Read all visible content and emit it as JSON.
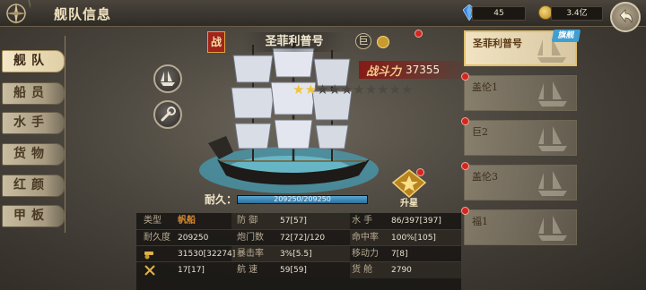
{
  "header": {
    "title": "舰队信息"
  },
  "currency": {
    "gems": "45",
    "coins": "3.4亿",
    "gem_icon": "blue-gem-icon",
    "coin_icon": "gold-coin-icon"
  },
  "nav": {
    "items": [
      {
        "label": "舰队",
        "active": true
      },
      {
        "label": "船员"
      },
      {
        "label": "水手"
      },
      {
        "label": "货物"
      },
      {
        "label": "红颜"
      },
      {
        "label": "甲板"
      }
    ]
  },
  "ship": {
    "type_badge": "战",
    "name": "圣菲利普号",
    "rank_badge": "巨",
    "power_label": "战斗力",
    "power_value": "37355",
    "stars_total": 10,
    "stars_filled": 2,
    "durability_label": "耐久：",
    "durability_text": "209250/209250",
    "durability_fraction": 1.0,
    "upgrade_label": "升星"
  },
  "stats": [
    [
      {
        "k": "类型",
        "v": "帆船"
      },
      {
        "k": "防 御",
        "v": "57[57]"
      },
      {
        "k": "水 手",
        "v": "86/397[397]"
      }
    ],
    [
      {
        "k": "耐久度",
        "v": "209250"
      },
      {
        "k": "炮门数",
        "v": "72[72]/120"
      },
      {
        "k": "命中率",
        "v": "100%[105]"
      }
    ],
    [
      {
        "k": "",
        "v": "31530[32274]"
      },
      {
        "k": "暴击率",
        "v": "3%[5.5]"
      },
      {
        "k": "移动力",
        "v": "7[8]"
      }
    ],
    [
      {
        "k": "",
        "v": "17[17]"
      },
      {
        "k": "航 速",
        "v": "59[59]"
      },
      {
        "k": "货 舱",
        "v": "2790"
      }
    ]
  ],
  "fleet": {
    "flagship_tag": "旗舰",
    "ships": [
      {
        "name": "圣菲利普号",
        "active": true
      },
      {
        "name": "盖伦1"
      },
      {
        "name": "巨2"
      },
      {
        "name": "盖伦3"
      },
      {
        "name": "福1"
      }
    ]
  },
  "colors": {
    "accent_gold": "#e1c06a",
    "alert_red": "#d3261f",
    "durability_blue": "#58a7d3",
    "battle_red": "#a1231c"
  }
}
